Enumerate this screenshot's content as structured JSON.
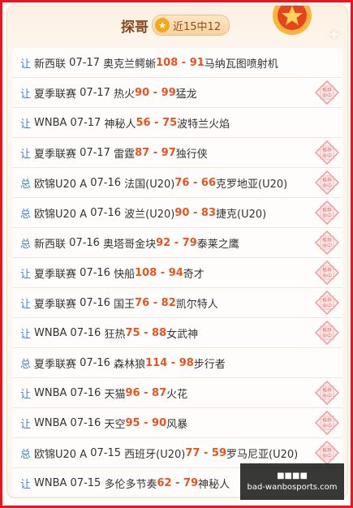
{
  "header": {
    "title": "探哥",
    "record_label": "近15中12",
    "accent_color": "#f0141a"
  },
  "rows": [
    {
      "kind": "让",
      "league": "新西联",
      "date": "07-17",
      "home": "奥克兰鳄蜥",
      "home_score": "108",
      "sep": " - ",
      "away_score": "91",
      "away": "马纳瓦图喷射机",
      "hit": false
    },
    {
      "kind": "让",
      "league": "夏季联赛",
      "date": "07-17",
      "home": "热火",
      "home_score": "90",
      "sep": " - ",
      "away_score": "99",
      "away": "猛龙",
      "hit": true
    },
    {
      "kind": "让",
      "league": "WNBA",
      "date": "07-17",
      "home": "神秘人",
      "home_score": "56",
      "sep": " - ",
      "away_score": "75",
      "away": "波特兰火焰",
      "hit": false
    },
    {
      "kind": "让",
      "league": "夏季联赛",
      "date": "07-17",
      "home": "雷霆",
      "home_score": "87",
      "sep": " - ",
      "away_score": "97",
      "away": "独行侠",
      "hit": true
    },
    {
      "kind": "总",
      "league": "欧锦U20 A",
      "date": "07-16",
      "home": "法国(U20)",
      "home_score": "76",
      "sep": " - ",
      "away_score": "66",
      "away": "克罗地亚(U20)",
      "hit": true
    },
    {
      "kind": "总",
      "league": "欧锦U20 A",
      "date": "07-16",
      "home": "波兰(U20)",
      "home_score": "90",
      "sep": " - ",
      "away_score": "83",
      "away": "捷克(U20)",
      "hit": true
    },
    {
      "kind": "总",
      "league": "新西联",
      "date": "07-16",
      "home": "奥塔哥金块",
      "home_score": "92",
      "sep": " - ",
      "away_score": "79",
      "away": "泰莱之鹰",
      "hit": true
    },
    {
      "kind": "让",
      "league": "夏季联赛",
      "date": "07-16",
      "home": "快船",
      "home_score": "108",
      "sep": " - ",
      "away_score": "94",
      "away": "奇才",
      "hit": true
    },
    {
      "kind": "让",
      "league": "夏季联赛",
      "date": "07-16",
      "home": "国王",
      "home_score": "76",
      "sep": " - ",
      "away_score": "82",
      "away": "凯尔特人",
      "hit": true
    },
    {
      "kind": "让",
      "league": "WNBA",
      "date": "07-16",
      "home": "狂热",
      "home_score": "75",
      "sep": " - ",
      "away_score": "88",
      "away": "女武神",
      "hit": true
    },
    {
      "kind": "总",
      "league": "夏季联赛",
      "date": "07-16",
      "home": "森林狼",
      "home_score": "114",
      "sep": " - ",
      "away_score": "98",
      "away": "步行者",
      "hit": false
    },
    {
      "kind": "让",
      "league": "WNBA",
      "date": "07-16",
      "home": "天猫",
      "home_score": "96",
      "sep": " - ",
      "away_score": "87",
      "away": "火花",
      "hit": true
    },
    {
      "kind": "让",
      "league": "WNBA",
      "date": "07-16",
      "home": "天空",
      "home_score": "95",
      "sep": " - ",
      "away_score": "90",
      "away": "风暴",
      "hit": true
    },
    {
      "kind": "总",
      "league": "欧锦U20 A",
      "date": "07-15",
      "home": "西班牙(U20)",
      "home_score": "77",
      "sep": " - ",
      "away_score": "59",
      "away": "罗马尼亚(U20)",
      "hit": true
    },
    {
      "kind": "让",
      "league": "WNBA",
      "date": "07-15",
      "home": "多伦多节奏",
      "home_score": "62",
      "sep": " - ",
      "away_score": "79",
      "away": "神秘人",
      "hit": false
    }
  ],
  "stamp_text": [
    "推荐",
    "命中"
  ],
  "watermark": {
    "line1": "■■■■",
    "line2": "bad-wanbosports.com"
  }
}
